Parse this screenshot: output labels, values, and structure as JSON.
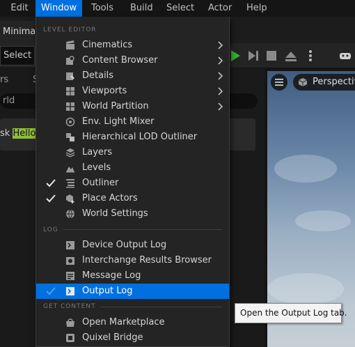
{
  "menubar": {
    "items": [
      {
        "label": "Edit",
        "active": false
      },
      {
        "label": "Window",
        "active": true
      },
      {
        "label": "Tools",
        "active": false
      },
      {
        "label": "Build",
        "active": false
      },
      {
        "label": "Select",
        "active": false
      },
      {
        "label": "Actor",
        "active": false
      },
      {
        "label": "Help",
        "active": false
      }
    ]
  },
  "editor": {
    "tab_label": "Minimal_",
    "select_mode_label": "Select M",
    "outliner_header_left": "rs",
    "outliner_header_right": "S",
    "search_value": "rld",
    "task_prefix": "sk",
    "task_highlight": "Hello",
    "viewport_label": "Perspective"
  },
  "menu": {
    "sections": [
      {
        "label": "LEVEL EDITOR"
      },
      {
        "label": "LOG"
      },
      {
        "label": "GET CONTENT"
      }
    ],
    "items": [
      {
        "label": "Cinematics",
        "icon": "film-icon",
        "submenu": true,
        "checked": false,
        "highlighted": false
      },
      {
        "label": "Content Browser",
        "icon": "content-browser-icon",
        "submenu": true,
        "checked": false,
        "highlighted": false
      },
      {
        "label": "Details",
        "icon": "details-icon",
        "submenu": true,
        "checked": false,
        "highlighted": false
      },
      {
        "label": "Viewports",
        "icon": "viewports-icon",
        "submenu": true,
        "checked": false,
        "highlighted": false
      },
      {
        "label": "World Partition",
        "icon": "world-partition-icon",
        "submenu": true,
        "checked": false,
        "highlighted": false
      },
      {
        "label": "Env. Light Mixer",
        "icon": "light-mixer-icon",
        "submenu": false,
        "checked": false,
        "highlighted": false
      },
      {
        "label": "Hierarchical LOD Outliner",
        "icon": "hlod-icon",
        "submenu": false,
        "checked": false,
        "highlighted": false
      },
      {
        "label": "Layers",
        "icon": "layers-icon",
        "submenu": false,
        "checked": false,
        "highlighted": false
      },
      {
        "label": "Levels",
        "icon": "levels-icon",
        "submenu": false,
        "checked": false,
        "highlighted": false
      },
      {
        "label": "Outliner",
        "icon": "outliner-icon",
        "submenu": false,
        "checked": true,
        "highlighted": false
      },
      {
        "label": "Place Actors",
        "icon": "place-actors-icon",
        "submenu": false,
        "checked": true,
        "highlighted": false
      },
      {
        "label": "World Settings",
        "icon": "world-settings-icon",
        "submenu": false,
        "checked": false,
        "highlighted": false
      },
      {
        "label": "Device Output Log",
        "icon": "device-log-icon",
        "submenu": false,
        "checked": false,
        "highlighted": false
      },
      {
        "label": "Interchange Results Browser",
        "icon": "interchange-icon",
        "submenu": false,
        "checked": false,
        "highlighted": false
      },
      {
        "label": "Message Log",
        "icon": "message-log-icon",
        "submenu": false,
        "checked": false,
        "highlighted": false
      },
      {
        "label": "Output Log",
        "icon": "output-log-icon",
        "submenu": false,
        "checked": true,
        "highlighted": true
      },
      {
        "label": "Open Marketplace",
        "icon": "marketplace-icon",
        "submenu": false,
        "checked": false,
        "highlighted": false
      },
      {
        "label": "Quixel Bridge",
        "icon": "bridge-icon",
        "submenu": false,
        "checked": false,
        "highlighted": false
      }
    ]
  },
  "tooltip": {
    "text": "Open the Output Log tab."
  },
  "colors": {
    "accent": "#0070e0",
    "menu_bg": "#242424",
    "green": "#2fb52f",
    "highlight": "#8fbd3a"
  }
}
